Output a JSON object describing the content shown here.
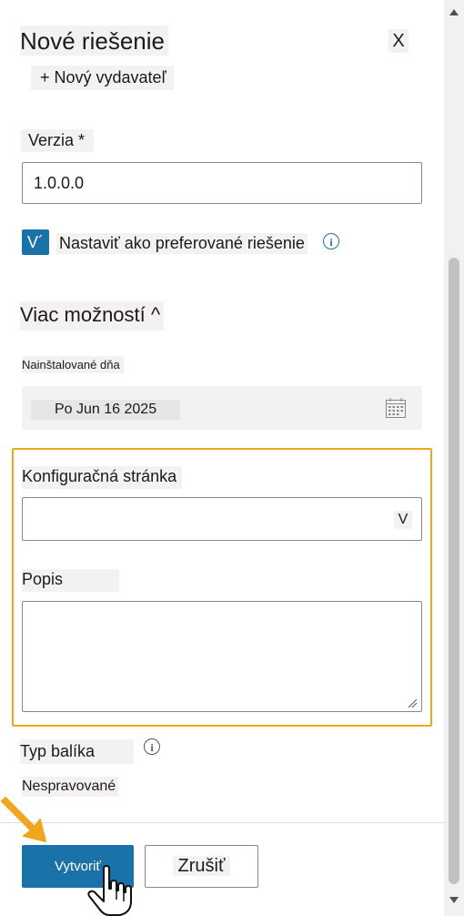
{
  "header": {
    "title": "Nové riešenie",
    "close_label": "X",
    "new_publisher_label": "+ Nový vydavateľ"
  },
  "version": {
    "label": "Verzia *",
    "value": "1.0.0.0"
  },
  "preferred": {
    "check_label": "V´",
    "label": "Nastaviť ako preferované riešenie",
    "info_icon": "i"
  },
  "more_options": {
    "label": "Viac možností ^"
  },
  "installed": {
    "label": "Nainštalované dňa",
    "value": "Po Jun 16 2025"
  },
  "config_page": {
    "label": "Konfiguračná stránka",
    "value": "",
    "chevron": "V"
  },
  "description": {
    "label": "Popis",
    "value": ""
  },
  "package_type": {
    "label": "Typ balíka",
    "info_icon": "i",
    "value": "Nespravované"
  },
  "footer": {
    "create_label": "Vytvoriť",
    "cancel_label": "Zrušiť"
  },
  "colors": {
    "accent": "#1a73a8",
    "highlight": "#f0a71f",
    "field_bg": "#f3f2f1"
  },
  "icons": [
    "close-icon",
    "info-icon",
    "calendar-icon",
    "chevron-down-icon",
    "resize-grip-icon",
    "arrow-pointer-icon",
    "hand-cursor-icon",
    "scroll-up-icon",
    "scroll-down-icon"
  ]
}
